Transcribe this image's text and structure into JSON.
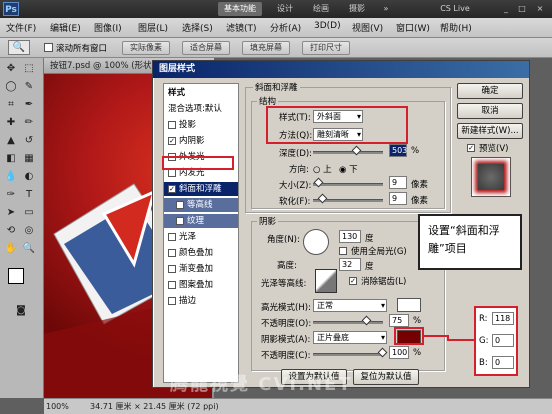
{
  "app": {
    "logo": "Ps",
    "workspace_buttons": [
      "基本功能",
      "设计",
      "绘画",
      "摄影"
    ],
    "search_label": "CS Live",
    "window_controls": [
      "_",
      "□",
      "×"
    ]
  },
  "menubar": [
    "文件(F)",
    "编辑(E)",
    "图像(I)",
    "图层(L)",
    "选择(S)",
    "滤镜(T)",
    "分析(A)",
    "3D(D)",
    "视图(V)",
    "窗口(W)",
    "帮助(H)"
  ],
  "options": {
    "scroll_all": "滚动所有窗口",
    "buttons": [
      "实际像素",
      "适合屏幕",
      "填充屏幕",
      "打印尺寸"
    ]
  },
  "document": {
    "tab_title": "按钮7.psd @ 100% (形状",
    "zoom": "100%",
    "doc_size": "34.71 厘米 × 21.45 厘米 (72 ppi)"
  },
  "dialog": {
    "title": "图层样式",
    "styles_header": "样式",
    "blend_options": "混合选项:默认",
    "style_items": [
      {
        "label": "投影",
        "checked": false
      },
      {
        "label": "内阴影",
        "checked": true
      },
      {
        "label": "外发光",
        "checked": false
      },
      {
        "label": "内发光",
        "checked": false
      },
      {
        "label": "斜面和浮雕",
        "checked": true
      },
      {
        "label": "等高线",
        "checked": false
      },
      {
        "label": "纹理",
        "checked": false
      },
      {
        "label": "光泽",
        "checked": false
      },
      {
        "label": "颜色叠加",
        "checked": false
      },
      {
        "label": "渐变叠加",
        "checked": false
      },
      {
        "label": "图案叠加",
        "checked": false
      },
      {
        "label": "描边",
        "checked": false
      }
    ],
    "panel_title": "斜面和浮雕",
    "structure": {
      "title": "结构",
      "style_label": "样式(T):",
      "style_value": "外斜面",
      "method_label": "方法(Q):",
      "method_value": "雕刻清晰",
      "depth_label": "深度(D):",
      "depth_value": "503",
      "depth_unit": "%",
      "direction_label": "方向:",
      "dir_up": "上",
      "dir_down": "下",
      "size_label": "大小(Z):",
      "size_value": "9",
      "size_unit": "像素",
      "soften_label": "软化(F):",
      "soften_value": "9",
      "soften_unit": "像素"
    },
    "shading": {
      "title": "阴影",
      "angle_label": "角度(N):",
      "angle_value": "130",
      "angle_unit": "度",
      "global_light": "使用全局光(G)",
      "altitude_label": "高度:",
      "altitude_value": "32",
      "altitude_unit": "度",
      "gloss_label": "光泽等高线:",
      "anti_alias": "消除锯齿(L)",
      "highlight_label": "高光模式(H):",
      "highlight_value": "正常",
      "highlight_color": "#ffffff",
      "hl_opacity_label": "不透明度(O):",
      "hl_opacity_value": "75",
      "shadow_label": "阴影模式(A):",
      "shadow_value": "正片叠底",
      "shadow_color": "#760000",
      "sh_opacity_label": "不透明度(C):",
      "sh_opacity_value": "100",
      "pct": "%"
    },
    "buttons": {
      "default_set": "设置为默认值",
      "default_reset": "复位为默认值",
      "ok": "确定",
      "cancel": "取消",
      "new_style": "新建样式(W)...",
      "preview": "预览(V)"
    }
  },
  "annotation": {
    "callout": "设置“斜面和浮雕”项目",
    "rgb": [
      {
        "label": "R:",
        "value": "118"
      },
      {
        "label": "G:",
        "value": "0"
      },
      {
        "label": "B:",
        "value": "0"
      }
    ],
    "accent": "#d4202c"
  },
  "watermark": "腾龍視覺 CVI.NET"
}
